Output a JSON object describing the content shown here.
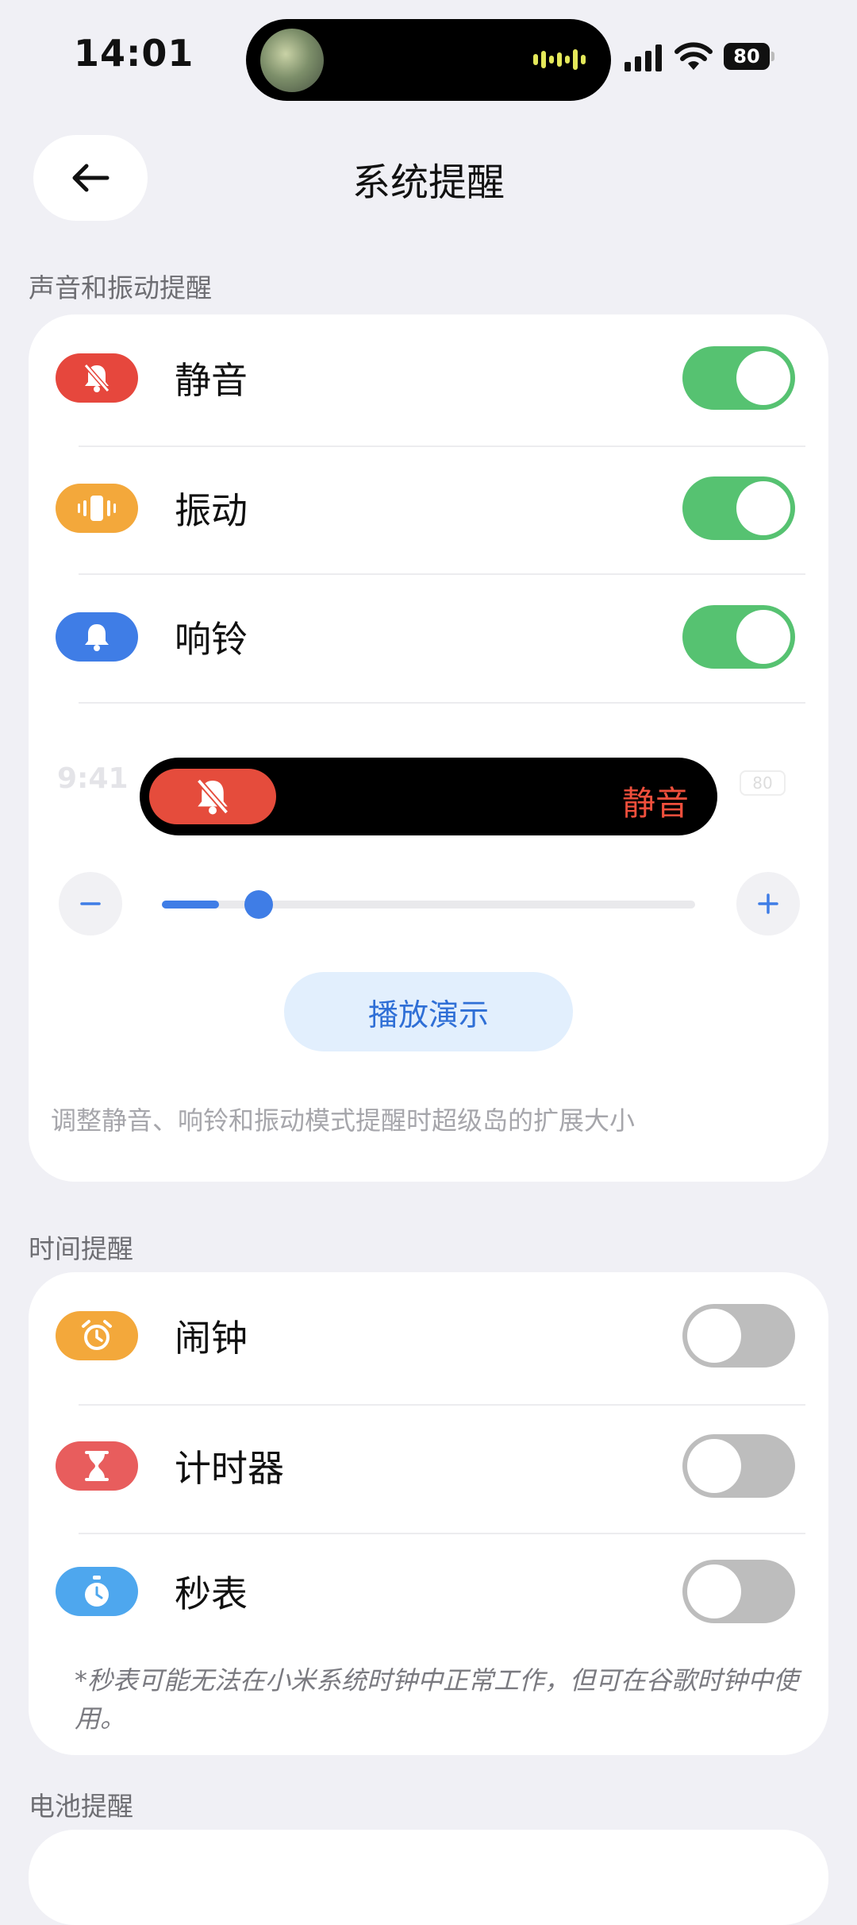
{
  "status_bar": {
    "time": "14:01",
    "battery": "80"
  },
  "header": {
    "title": "系统提醒"
  },
  "sections": {
    "sound": {
      "label": "声音和振动提醒",
      "items": [
        {
          "label": "静音",
          "on": true,
          "icon": "bell-slash-icon",
          "color": "#e6473d"
        },
        {
          "label": "振动",
          "on": true,
          "icon": "vibrate-icon",
          "color": "#f3a83b"
        },
        {
          "label": "响铃",
          "on": true,
          "icon": "bell-icon",
          "color": "#3f7de6"
        }
      ],
      "preview": {
        "ghost_time": "9:41",
        "ghost_battery": "80",
        "mute_text": "静音"
      },
      "slider": {
        "value_fraction": 0.08
      },
      "play_button": "播放演示",
      "hint": "调整静音、响铃和振动模式提醒时超级岛的扩展大小"
    },
    "time": {
      "label": "时间提醒",
      "items": [
        {
          "label": "闹钟",
          "on": false,
          "icon": "alarm-clock-icon",
          "color": "#f3a83b"
        },
        {
          "label": "计时器",
          "on": false,
          "icon": "hourglass-icon",
          "color": "#e85d5d"
        },
        {
          "label": "秒表",
          "on": false,
          "icon": "stopwatch-icon",
          "color": "#4ea7ee"
        }
      ],
      "note": "*秒表可能无法在小米系统时钟中正常工作，但可在谷歌时钟中使用。"
    },
    "battery": {
      "label": "电池提醒"
    }
  }
}
